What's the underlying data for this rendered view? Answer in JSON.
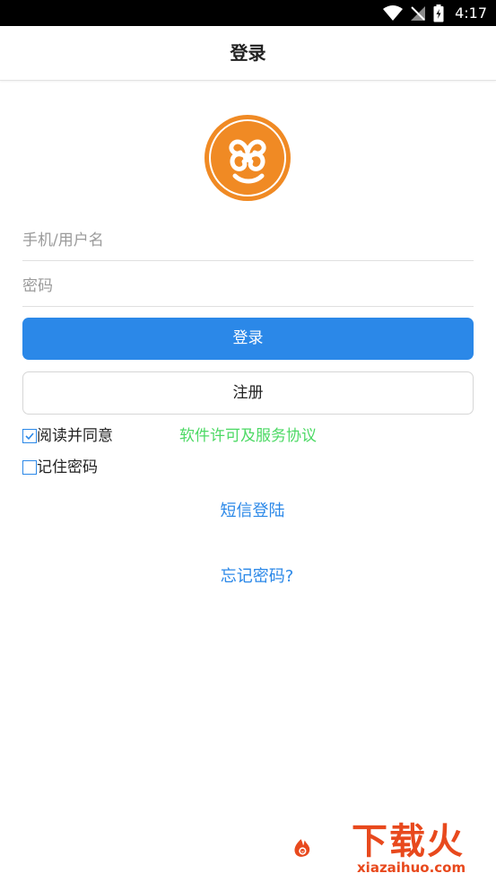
{
  "status_bar": {
    "time": "4:17",
    "icons": [
      "wifi-icon",
      "no-signal-icon",
      "battery-charging-icon"
    ]
  },
  "nav": {
    "title": "登录"
  },
  "logo": {
    "icon": "swirl-logo-icon",
    "color": "#f08a24"
  },
  "form": {
    "username_placeholder": "手机/用户名",
    "username_value": "",
    "password_placeholder": "密码",
    "password_value": ""
  },
  "buttons": {
    "login_label": "登录",
    "register_label": "注册"
  },
  "agreement": {
    "checked": true,
    "label": "阅读并同意",
    "link_label": "软件许可及服务协议"
  },
  "remember": {
    "checked": false,
    "label": "记住密码"
  },
  "links": {
    "sms_login": "短信登陆",
    "forgot_password": "忘记密码?"
  },
  "watermark": {
    "text": "下载火",
    "sub": "xiazaihuo.com"
  },
  "colors": {
    "primary": "#2b88e8",
    "accent_green": "#4cd964",
    "logo_orange": "#f08a24",
    "watermark": "#e8491d"
  }
}
